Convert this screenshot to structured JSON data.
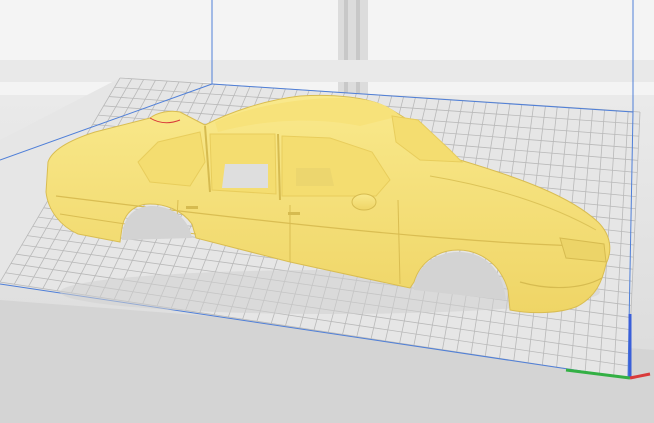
{
  "viewport": {
    "background": "#f4f4f4",
    "plate_color": "#e6e6e6",
    "grid_color": "#b9b9b9",
    "build_volume_color": "#4f7fd8"
  },
  "model": {
    "name": "sedan-car-body",
    "color": "#f7e27a",
    "shade_color": "#e8cd5c",
    "window_color": "#f4dd70"
  },
  "axis_gizmo": {
    "x_color": "#d93a3a",
    "y_color": "#33b044",
    "z_color": "#3a5fd9"
  }
}
